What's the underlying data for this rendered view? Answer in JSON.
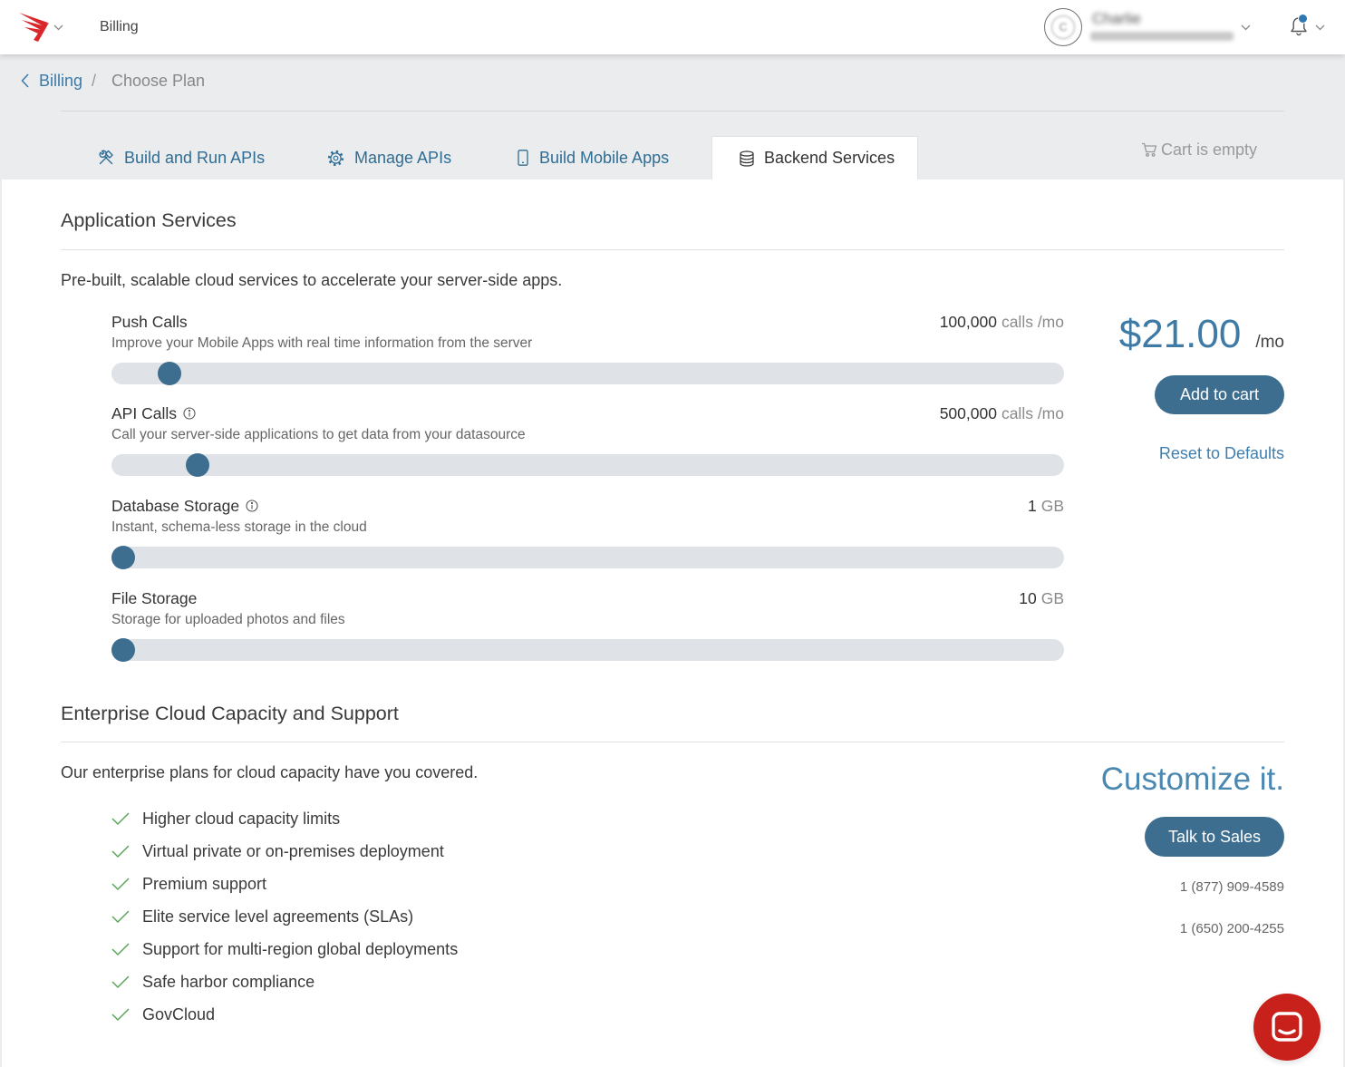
{
  "header": {
    "logo_icon": "brand-logo-icon",
    "menu_icon": "chevron-down-icon",
    "section_label": "Billing",
    "user": {
      "avatar_initial": "C",
      "name": "Charlie",
      "menu_icon": "chevron-down-icon"
    },
    "notifications": {
      "icon": "bell-icon",
      "has_unread": true,
      "menu_icon": "chevron-down-icon"
    }
  },
  "breadcrumb": {
    "back_icon": "chevron-left-icon",
    "parent": "Billing",
    "separator": "/",
    "current": "Choose Plan"
  },
  "tabs": [
    {
      "label": "Build and Run APIs",
      "icon": "tools-icon",
      "active": false
    },
    {
      "label": "Manage APIs",
      "icon": "gear-icon",
      "active": false
    },
    {
      "label": "Build Mobile Apps",
      "icon": "mobile-phone-icon",
      "active": false
    },
    {
      "label": "Backend Services",
      "icon": "database-icon",
      "active": true
    }
  ],
  "cart": {
    "icon": "cart-icon",
    "label": "Cart is empty"
  },
  "app_services": {
    "title": "Application Services",
    "intro": "Pre-built, scalable cloud services to accelerate your server-side apps.",
    "sliders": [
      {
        "label": "Push Calls",
        "info_icon": false,
        "description": "Improve your Mobile Apps with real time information from the server",
        "value": "100,000",
        "unit": "calls /mo",
        "level": 0.05
      },
      {
        "label": "API Calls",
        "info_icon": true,
        "description": "Call your server-side applications to get data from your datasource",
        "value": "500,000",
        "unit": "calls /mo",
        "level": 0.08
      },
      {
        "label": "Database Storage",
        "info_icon": true,
        "description": "Instant, schema-less storage in the cloud",
        "value": "1",
        "unit": "GB",
        "level": 0
      },
      {
        "label": "File Storage",
        "info_icon": false,
        "description": "Storage for uploaded photos and files",
        "value": "10",
        "unit": "GB",
        "level": 0
      }
    ]
  },
  "pricing": {
    "amount": "$21.00",
    "period": "/mo",
    "add_to_cart_label": "Add to cart",
    "reset_label": "Reset to Defaults"
  },
  "enterprise": {
    "title": "Enterprise Cloud Capacity and Support",
    "intro": "Our enterprise plans for cloud capacity have you covered.",
    "feature_icon": "check-icon",
    "features": [
      "Higher cloud capacity limits",
      "Virtual private or on-premises deployment",
      "Premium support",
      "Elite service level agreements (SLAs)",
      "Support for multi-region global deployments",
      "Safe harbor compliance",
      "GovCloud"
    ],
    "cta_heading": "Customize it.",
    "talk_to_sales_label": "Talk to Sales",
    "phones": [
      "1 (877) 909-4589",
      "1 (650) 200-4255"
    ]
  },
  "chat": {
    "icon": "chat-icon"
  },
  "colors": {
    "accent": "#3a7aa8",
    "tab": "#2f6d94",
    "button": "#3d6e90",
    "track": "#dfe2e6",
    "check": "#5aa55a",
    "chat": "#c8201b",
    "brand": "#d8262b",
    "price": "#3d7ba6",
    "cta": "#4a88b2"
  }
}
